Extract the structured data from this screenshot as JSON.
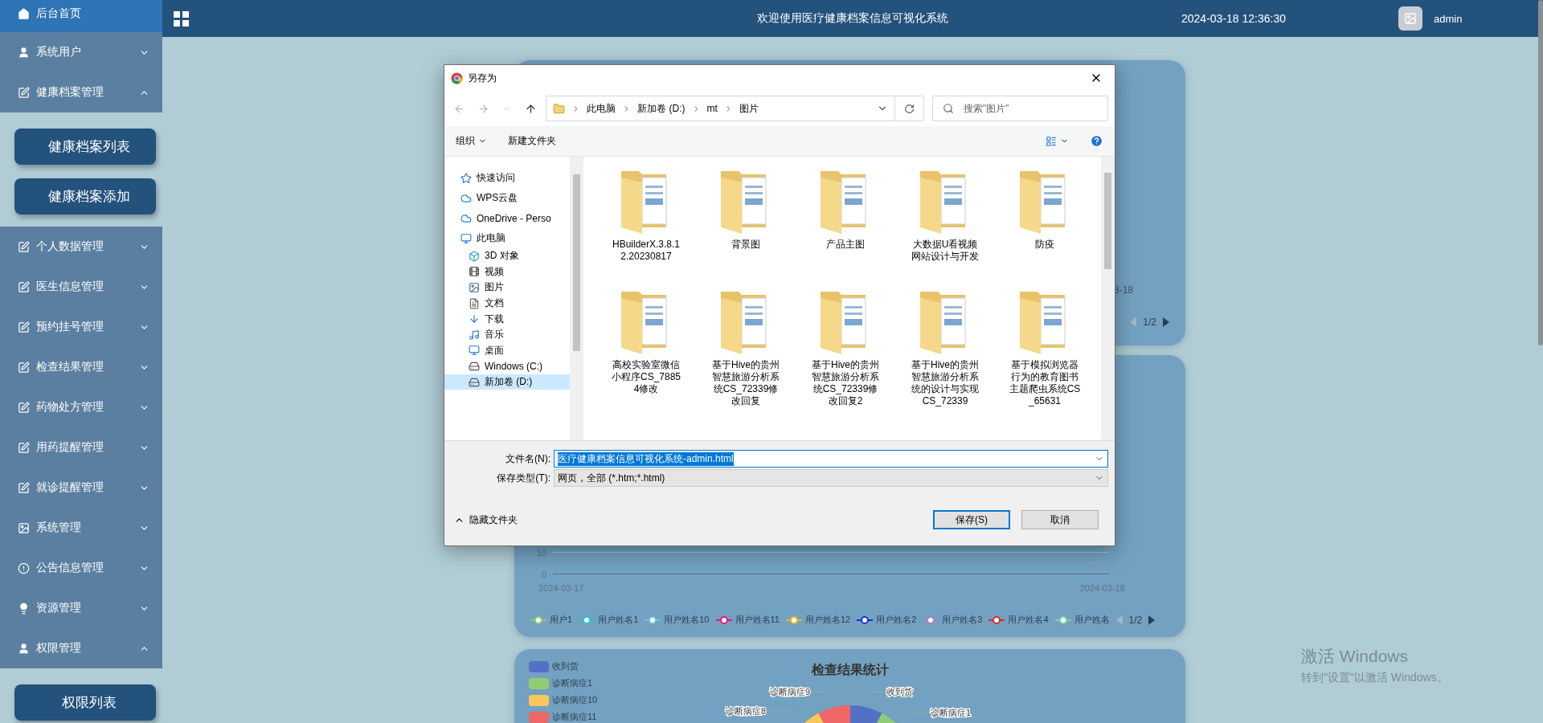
{
  "sidebar": {
    "items": [
      {
        "label": "后台首页",
        "kind": "home",
        "selected": true
      },
      {
        "label": "系统用户",
        "kind": "user",
        "selected": false,
        "expanded": false
      },
      {
        "label": "健康档案管理",
        "kind": "note",
        "selected": false,
        "expanded": true,
        "children": [
          {
            "label": "健康档案列表"
          },
          {
            "label": "健康档案添加"
          }
        ]
      },
      {
        "label": "个人数据管理",
        "kind": "note",
        "selected": false,
        "expanded": false
      },
      {
        "label": "医生信息管理",
        "kind": "note",
        "selected": false,
        "expanded": false
      },
      {
        "label": "预约挂号管理",
        "kind": "note",
        "selected": false,
        "expanded": false
      },
      {
        "label": "检查结果管理",
        "kind": "note",
        "selected": false,
        "expanded": false
      },
      {
        "label": "药物处方管理",
        "kind": "note",
        "selected": false,
        "expanded": false
      },
      {
        "label": "用药提醒管理",
        "kind": "note",
        "selected": false,
        "expanded": false
      },
      {
        "label": "就诊提醒管理",
        "kind": "note",
        "selected": false,
        "expanded": false
      },
      {
        "label": "系统管理",
        "kind": "image",
        "selected": false,
        "expanded": false
      },
      {
        "label": "公告信息管理",
        "kind": "info",
        "selected": false,
        "expanded": false
      },
      {
        "label": "资源管理",
        "kind": "bulb",
        "selected": false,
        "expanded": false
      },
      {
        "label": "权限管理",
        "kind": "user",
        "selected": false,
        "expanded": true,
        "children": [
          {
            "label": "权限列表"
          }
        ]
      }
    ]
  },
  "header": {
    "title": "欢迎使用医疗健康档案信息可视化系统",
    "datetime": "2024-03-18 12:36:30",
    "user": "admin"
  },
  "dashboard": {
    "card_1": {
      "axis_label": "3-18",
      "pager": {
        "text": "1/2",
        "prev_disabled": true,
        "next_disabled": false
      }
    },
    "line_chart": {
      "y_ticks": [
        "10",
        "0"
      ],
      "x_labels": [
        "2024-03-17",
        "2024-03-18"
      ],
      "legend": [
        {
          "label": "用户1",
          "color": "#91cc75"
        },
        {
          "label": "用户姓名1",
          "color": "#2ec7c9"
        },
        {
          "label": "用户姓名10",
          "color": "#73c0de"
        },
        {
          "label": "用户姓名11",
          "color": "#e7177f"
        },
        {
          "label": "用户姓名12",
          "color": "#e8b52a"
        },
        {
          "label": "用户姓名2",
          "color": "#1b2fd8"
        },
        {
          "label": "用户姓名3",
          "color": "#b07cc6"
        },
        {
          "label": "用户姓名4",
          "color": "#dd2a2a"
        },
        {
          "label": "用户姓名",
          "color": "#7fd6a0"
        }
      ],
      "pager": {
        "text": "1/2",
        "prev_disabled": true,
        "next_disabled": false
      }
    },
    "pie_chart": {
      "title": "检查结果统计",
      "legend": [
        {
          "label": "收到货",
          "color": "#5470c6"
        },
        {
          "label": "诊断病症1",
          "color": "#91cc75"
        },
        {
          "label": "诊断病症10",
          "color": "#fac858"
        },
        {
          "label": "诊断病症11",
          "color": "#ee6666"
        }
      ],
      "slice_labels": [
        "诊断病症9",
        "收到货",
        "诊断病症8",
        "诊断病症1"
      ]
    }
  },
  "dialog": {
    "title": "另存为",
    "breadcrumb": [
      "此电脑",
      "新加卷 (D:)",
      "mt",
      "图片"
    ],
    "search": {
      "placeholder": "搜索\"图片\""
    },
    "toolbar": {
      "organize": "组织",
      "new_folder": "新建文件夹"
    },
    "nav": [
      {
        "label": "快速访问",
        "kind": "star",
        "selected": false
      },
      {
        "label": "WPS云盘",
        "kind": "cloud",
        "selected": false
      },
      {
        "label": "OneDrive - Perso",
        "kind": "cloud",
        "selected": false
      },
      {
        "label": "此电脑",
        "kind": "pc",
        "selected": false,
        "children": [
          {
            "label": "3D 对象",
            "kind": "cube",
            "selected": false
          },
          {
            "label": "视频",
            "kind": "film",
            "selected": false
          },
          {
            "label": "图片",
            "kind": "picture",
            "selected": false
          },
          {
            "label": "文档",
            "kind": "doc",
            "selected": false
          },
          {
            "label": "下载",
            "kind": "download",
            "selected": false
          },
          {
            "label": "音乐",
            "kind": "music",
            "selected": false
          },
          {
            "label": "桌面",
            "kind": "desktop",
            "selected": false
          },
          {
            "label": "Windows (C:)",
            "kind": "drive",
            "selected": false
          },
          {
            "label": "新加卷 (D:)",
            "kind": "drive",
            "selected": true
          }
        ]
      }
    ],
    "files": [
      {
        "name": "HBuilderX.3.8.12.20230817"
      },
      {
        "name": "背景图"
      },
      {
        "name": "产品主图"
      },
      {
        "name": "大数据U看视频网站设计与开发"
      },
      {
        "name": "防疫"
      },
      {
        "name": "高校实验室微信小程序CS_78854修改"
      },
      {
        "name": "基于Hive的贵州智慧旅游分析系统CS_72339修改回复"
      },
      {
        "name": "基于Hive的贵州智慧旅游分析系统CS_72339修改回复2"
      },
      {
        "name": "基于Hive的贵州智慧旅游分析系统的设计与实现CS_72339"
      },
      {
        "name": "基于模拟浏览器行为的教育图书主题爬虫系统CS_65631"
      }
    ],
    "filename": {
      "label": "文件名(N):",
      "value": "医疗健康档案信息可视化系统-admin.html",
      "highlighted": true
    },
    "filetype": {
      "label": "保存类型(T):",
      "value": "网页，全部 (*.htm;*.html)"
    },
    "hide_folders": "隐藏文件夹",
    "buttons": [
      {
        "label": "保存(S)",
        "default": true
      },
      {
        "label": "取消",
        "default": false
      }
    ]
  },
  "windows_notice": {
    "title": "激活 Windows",
    "subtitle": "转到\"设置\"以激活 Windows。"
  }
}
